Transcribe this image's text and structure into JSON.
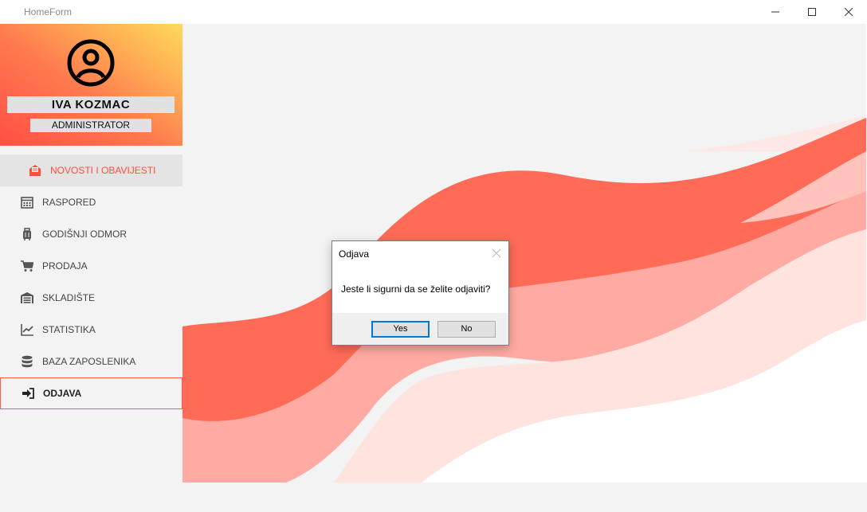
{
  "window": {
    "title": "HomeForm",
    "controls": [
      "minimize-icon",
      "maximize-icon",
      "close-icon"
    ]
  },
  "profile": {
    "avatar_icon": "user-circle-icon",
    "name": "IVA KOZMAC",
    "role": "ADMINISTRATOR",
    "gradient_colors": [
      "#ff4f45",
      "#ff7a4f",
      "#ffb054",
      "#ffd95a"
    ]
  },
  "nav": {
    "items": [
      {
        "label": "NOVOSTI I OBAVIJESTI",
        "icon": "mail-icon",
        "state": "active"
      },
      {
        "label": "RASPORED",
        "icon": "calendar-icon"
      },
      {
        "label": "GODIŠNJI ODMOR",
        "icon": "suitcase-icon"
      },
      {
        "label": "PRODAJA",
        "icon": "cart-icon"
      },
      {
        "label": "SKLADIŠTE",
        "icon": "warehouse-icon"
      },
      {
        "label": "STATISTIKA",
        "icon": "chart-line-icon"
      },
      {
        "label": "BAZA ZAPOSLENIKA",
        "icon": "database-icon"
      },
      {
        "label": "ODJAVA",
        "icon": "sign-out-icon",
        "state": "selected"
      }
    ]
  },
  "dialog": {
    "title": "Odjava",
    "message": "Jeste li sigurni da se želite odjaviti?",
    "yes_label": "Yes",
    "no_label": "No"
  },
  "colors": {
    "accent": "#ff4d3d",
    "wave_dark": "#ff6b57",
    "wave_mid": "#ffaaa2",
    "wave_light": "#ffe3df",
    "background": "#f3f3f3"
  }
}
